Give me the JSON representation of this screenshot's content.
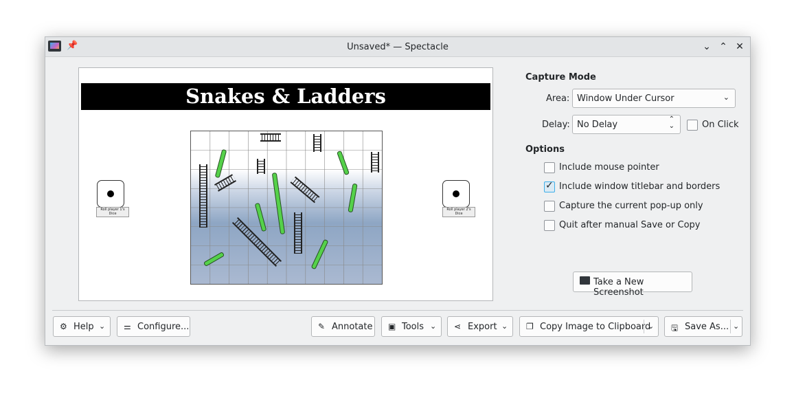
{
  "window": {
    "title": "Unsaved* — Spectacle",
    "buttons": [
      "minimize",
      "maximize",
      "close"
    ]
  },
  "preview": {
    "banner": "Snakes & Ladders",
    "dice": [
      {
        "label": "Roll player 1's Dice"
      },
      {
        "label": "Roll player 2's Dice"
      }
    ]
  },
  "capture_mode": {
    "heading": "Capture Mode",
    "area_label": "Area:",
    "area_value": "Window Under Cursor",
    "delay_label": "Delay:",
    "delay_value": "No Delay",
    "on_click_label": "On Click",
    "on_click_checked": false
  },
  "options": {
    "heading": "Options",
    "items": [
      {
        "label": "Include mouse pointer",
        "checked": false
      },
      {
        "label": "Include window titlebar and borders",
        "checked": true
      },
      {
        "label": "Capture the current pop-up only",
        "checked": false
      },
      {
        "label": "Quit after manual Save or Copy",
        "checked": false
      }
    ]
  },
  "new_screenshot_label": "Take a New Screenshot",
  "footer": {
    "help": "Help",
    "configure": "Configure...",
    "annotate": "Annotate",
    "tools": "Tools",
    "export": "Export",
    "copy": "Copy Image to Clipboard",
    "save": "Save As..."
  },
  "icons": {
    "app": "spectacle-app-icon",
    "pin": "pin-icon",
    "minimize": "chevron-down-icon",
    "maximize": "chevron-up-icon",
    "close": "close-icon",
    "help": "help-icon",
    "configure": "configure-icon",
    "annotate": "annotate-icon",
    "tools": "toolbox-icon",
    "export": "share-icon",
    "copy": "copy-icon",
    "save": "save-icon",
    "new_screenshot": "screenshot-icon"
  }
}
